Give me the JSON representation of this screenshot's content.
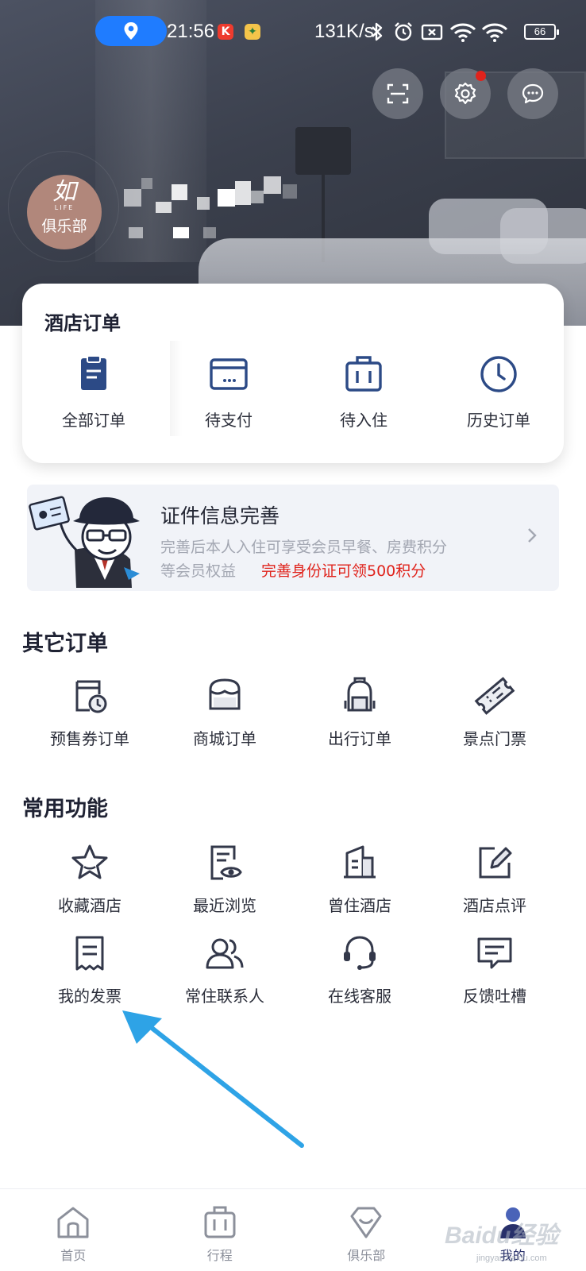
{
  "status_bar": {
    "time": "21:56",
    "network_speed": "131K/s",
    "battery": "66"
  },
  "header": {
    "avatar_logo": "如",
    "avatar_sub": "LIFE",
    "avatar_club": "俱乐部"
  },
  "hotel_orders": {
    "title": "酒店订单",
    "items": [
      {
        "label": "全部订单",
        "icon": "clipboard-icon"
      },
      {
        "label": "待支付",
        "icon": "wallet-icon"
      },
      {
        "label": "待入住",
        "icon": "suitcase-icon"
      },
      {
        "label": "历史订单",
        "icon": "clock-icon"
      }
    ]
  },
  "banner": {
    "title": "证件信息完善",
    "desc_line1": "完善后本人入住可享受会员早餐、房费积分",
    "desc_line2": "等会员权益",
    "promo": "完善身份证可领500积分"
  },
  "other_orders": {
    "title": "其它订单",
    "items": [
      {
        "label": "预售券订单",
        "icon": "presale-coupon-icon"
      },
      {
        "label": "商城订单",
        "icon": "shop-icon"
      },
      {
        "label": "出行订单",
        "icon": "backpack-icon"
      },
      {
        "label": "景点门票",
        "icon": "ticket-icon"
      }
    ]
  },
  "common_functions": {
    "title": "常用功能",
    "items": [
      {
        "label": "收藏酒店",
        "icon": "star-icon"
      },
      {
        "label": "最近浏览",
        "icon": "history-eye-icon"
      },
      {
        "label": "曾住酒店",
        "icon": "building-icon"
      },
      {
        "label": "酒店点评",
        "icon": "edit-icon"
      },
      {
        "label": "我的发票",
        "icon": "invoice-icon"
      },
      {
        "label": "常住联系人",
        "icon": "contacts-icon"
      },
      {
        "label": "在线客服",
        "icon": "headset-icon"
      },
      {
        "label": "反馈吐槽",
        "icon": "feedback-icon"
      }
    ]
  },
  "bottom_nav": {
    "items": [
      {
        "label": "首页",
        "icon": "home-icon"
      },
      {
        "label": "行程",
        "icon": "luggage-icon"
      },
      {
        "label": "俱乐部",
        "icon": "diamond-icon"
      },
      {
        "label": "我的",
        "icon": "profile-icon"
      }
    ],
    "active_index": 3
  },
  "watermark": {
    "text": "Baidu经验",
    "sub": "jingyan.baidu.com"
  },
  "colors": {
    "accent": "#28306a",
    "icon_blue": "#3a5a8c",
    "promo_red": "#e0231c",
    "location_pill": "#1f7cff",
    "annotation_arrow": "#2ea3e6"
  }
}
